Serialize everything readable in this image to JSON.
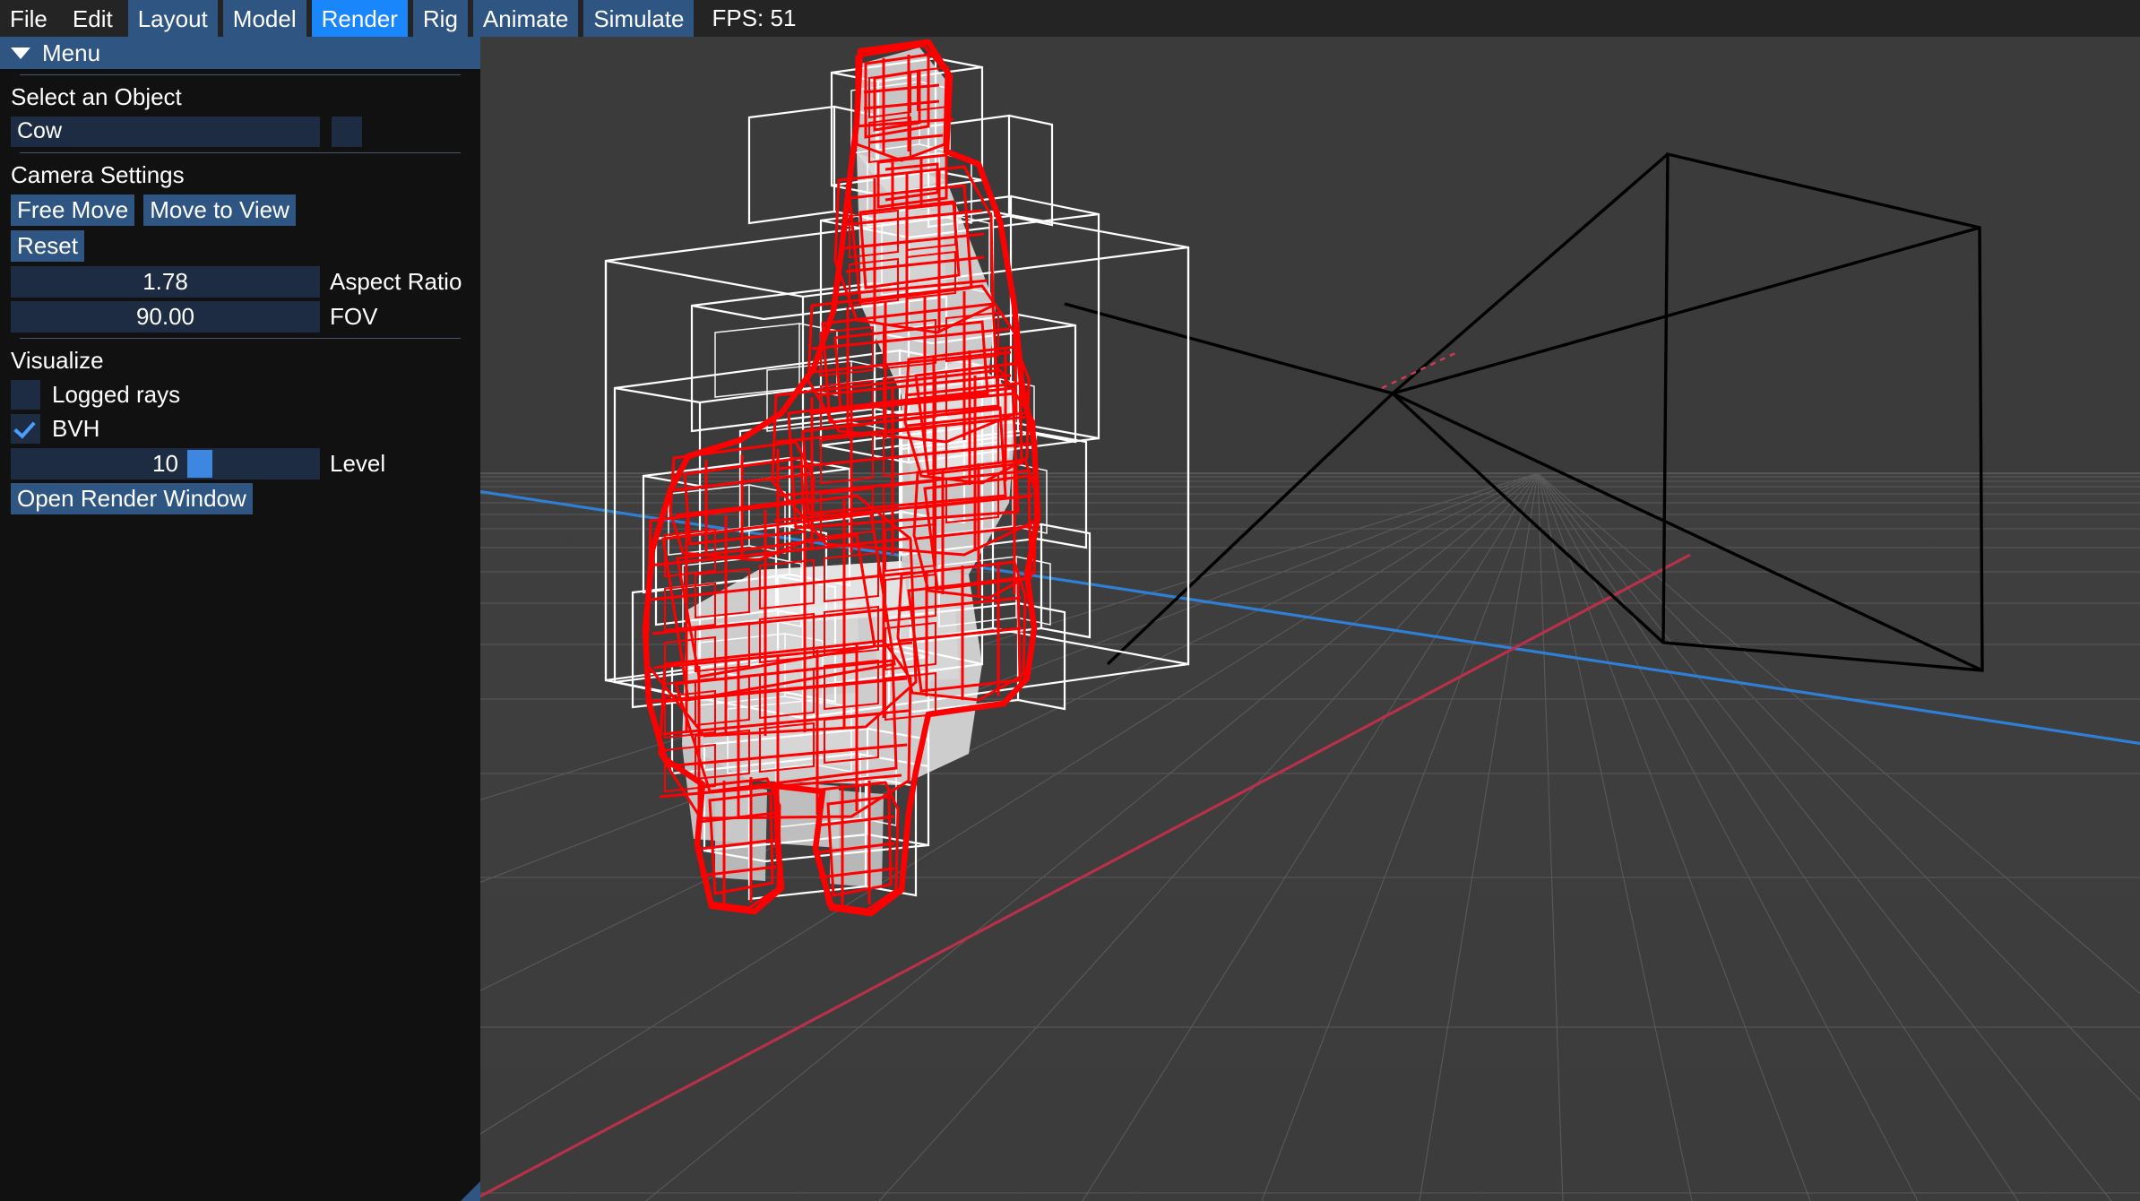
{
  "menubar": {
    "items": [
      {
        "label": "File",
        "style": "plain"
      },
      {
        "label": "Edit",
        "style": "plain"
      },
      {
        "label": "Layout",
        "style": "tinted"
      },
      {
        "label": "Model",
        "style": "tinted"
      },
      {
        "label": "Render",
        "style": "active"
      },
      {
        "label": "Rig",
        "style": "tinted"
      },
      {
        "label": "Animate",
        "style": "tinted"
      },
      {
        "label": "Simulate",
        "style": "tinted"
      }
    ],
    "fps": "FPS: 51"
  },
  "panel": {
    "title": "Menu",
    "caret_icon": "chevron-down-icon",
    "select_object": {
      "label": "Select an Object",
      "value": "Cow",
      "dropdown_icon": "dropdown-button"
    },
    "camera": {
      "label": "Camera Settings",
      "free_move": "Free Move",
      "move_to_view": "Move to View",
      "reset": "Reset",
      "aspect_ratio": {
        "value": "1.78",
        "label": "Aspect Ratio"
      },
      "fov": {
        "value": "90.00",
        "label": "FOV"
      }
    },
    "visualize": {
      "label": "Visualize",
      "logged_rays": {
        "label": "Logged rays",
        "checked": false
      },
      "bvh": {
        "label": "BVH",
        "checked": true
      },
      "level": {
        "value": "10",
        "label": "Level",
        "handle_pct": 62
      },
      "open_render_window": "Open Render Window"
    }
  },
  "viewport": {
    "scene_name": "3d-scene-viewport",
    "objects": {
      "bvh_wireframe_color": "#ff0000",
      "bounding_box_color": "#ffffff",
      "mesh_color": "#d8d8d8",
      "camera_frustum_color": "#000000",
      "grid_color": "#6f6f6f",
      "axis_x_color": "#c0304a",
      "axis_z_color": "#2f7fd4",
      "background_color": "#3a3a3a",
      "ground_color": "#3f3f3f"
    }
  },
  "colors": {
    "accent_active": "#1a86fb",
    "accent_tint": "#2f5583",
    "widget_bg": "#1d2c42",
    "panel_bg": "#111111",
    "menubar_bg": "#242424",
    "slider_handle": "#3d87e0",
    "check_mark": "#4a9eff"
  }
}
